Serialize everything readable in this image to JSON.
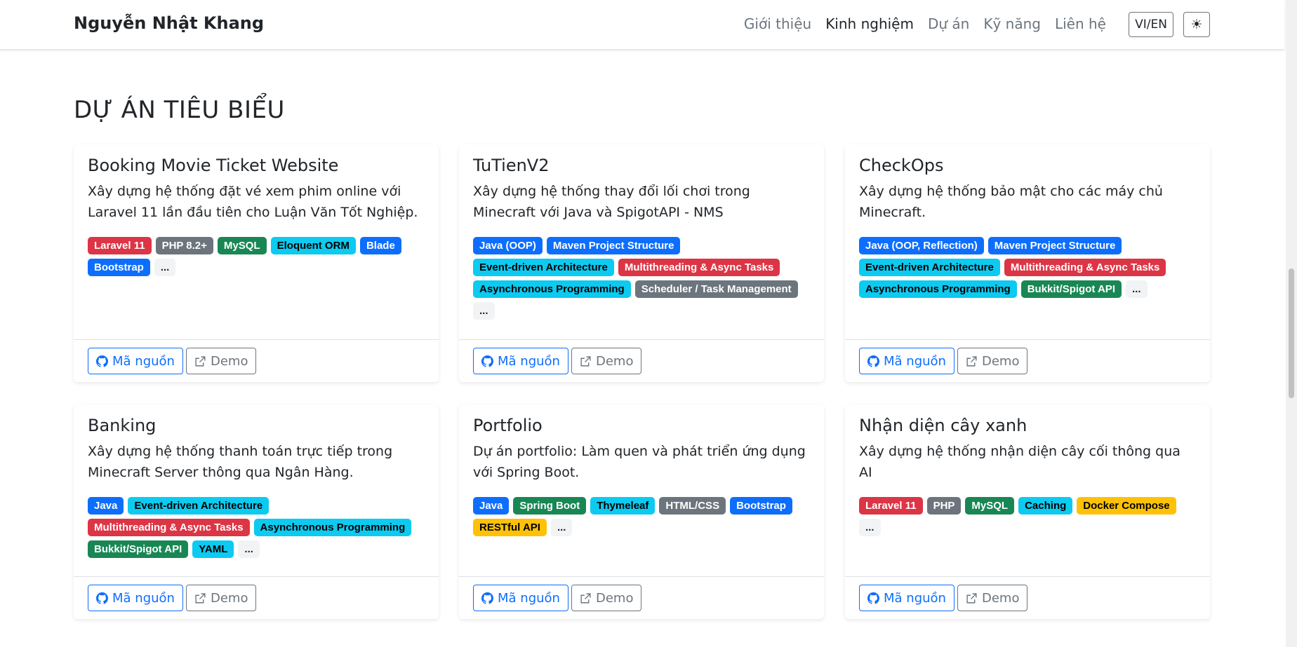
{
  "navbar": {
    "brand": "Nguyễn Nhật Khang",
    "links": [
      {
        "label": "Giới thiệu",
        "active": false
      },
      {
        "label": "Kinh nghiệm",
        "active": true
      },
      {
        "label": "Dự án",
        "active": false
      },
      {
        "label": "Kỹ năng",
        "active": false
      },
      {
        "label": "Liên hệ",
        "active": false
      }
    ],
    "lang_label": "VI/EN",
    "theme_icon": "sun-icon",
    "theme_glyph": "☀"
  },
  "section_title": "DỰ ÁN TIÊU BIỂU",
  "colors": {
    "danger": "#dc3545",
    "secondary": "#6c757d",
    "success": "#198754",
    "info": "#0dcaf0",
    "primary": "#0d6efd",
    "warning": "#ffc107"
  },
  "projects": [
    {
      "title": "Booking Movie Ticket Website",
      "description": "Xây dựng hệ thống đặt vé xem phim online với Laravel 11 lần đầu tiên cho Luận Văn Tốt Nghiệp.",
      "tags": [
        {
          "label": "Laravel 11",
          "color": "#dc3545",
          "text": "#ffffff"
        },
        {
          "label": "PHP 8.2+",
          "color": "#6c757d",
          "text": "#ffffff"
        },
        {
          "label": "MySQL",
          "color": "#198754",
          "text": "#ffffff"
        },
        {
          "label": "Eloquent ORM",
          "color": "#0dcaf0",
          "text": "#000000"
        },
        {
          "label": "Blade",
          "color": "#0d6efd",
          "text": "#ffffff"
        },
        {
          "label": "Bootstrap",
          "color": "#0d6efd",
          "text": "#ffffff"
        },
        {
          "label": "...",
          "color": "",
          "text": ""
        }
      ],
      "source_label": "Mã nguồn",
      "demo_label": "Demo"
    },
    {
      "title": "TuTienV2",
      "description": "Xây dựng hệ thống thay đổi lối chơi trong Minecraft với Java và SpigotAPI - NMS",
      "tags": [
        {
          "label": "Java (OOP)",
          "color": "#0d6efd",
          "text": "#ffffff"
        },
        {
          "label": "Maven Project Structure",
          "color": "#0d6efd",
          "text": "#ffffff"
        },
        {
          "label": "Event-driven Architecture",
          "color": "#0dcaf0",
          "text": "#000000"
        },
        {
          "label": "Multithreading & Async Tasks",
          "color": "#dc3545",
          "text": "#ffffff"
        },
        {
          "label": "Asynchronous Programming",
          "color": "#0dcaf0",
          "text": "#000000"
        },
        {
          "label": "Scheduler / Task Management",
          "color": "#6c757d",
          "text": "#ffffff"
        },
        {
          "label": "...",
          "color": "",
          "text": ""
        }
      ],
      "source_label": "Mã nguồn",
      "demo_label": "Demo"
    },
    {
      "title": "CheckOps",
      "description": "Xây dựng hệ thống bảo mật cho các máy chủ Minecraft.",
      "tags": [
        {
          "label": "Java (OOP, Reflection)",
          "color": "#0d6efd",
          "text": "#ffffff"
        },
        {
          "label": "Maven Project Structure",
          "color": "#0d6efd",
          "text": "#ffffff"
        },
        {
          "label": "Event-driven Architecture",
          "color": "#0dcaf0",
          "text": "#000000"
        },
        {
          "label": "Multithreading & Async Tasks",
          "color": "#dc3545",
          "text": "#ffffff"
        },
        {
          "label": "Asynchronous Programming",
          "color": "#0dcaf0",
          "text": "#000000"
        },
        {
          "label": "Bukkit/Spigot API",
          "color": "#198754",
          "text": "#ffffff"
        },
        {
          "label": "...",
          "color": "",
          "text": ""
        }
      ],
      "source_label": "Mã nguồn",
      "demo_label": "Demo"
    },
    {
      "title": "Banking",
      "description": "Xây dựng hệ thống thanh toán trực tiếp trong Minecraft Server thông qua Ngân Hàng.",
      "tags": [
        {
          "label": "Java",
          "color": "#0d6efd",
          "text": "#ffffff"
        },
        {
          "label": "Event-driven Architecture",
          "color": "#0dcaf0",
          "text": "#000000"
        },
        {
          "label": "Multithreading & Async Tasks",
          "color": "#dc3545",
          "text": "#ffffff"
        },
        {
          "label": "Asynchronous Programming",
          "color": "#0dcaf0",
          "text": "#000000"
        },
        {
          "label": "Bukkit/Spigot API",
          "color": "#198754",
          "text": "#ffffff"
        },
        {
          "label": "YAML",
          "color": "#0dcaf0",
          "text": "#000000"
        },
        {
          "label": "...",
          "color": "",
          "text": ""
        }
      ],
      "source_label": "Mã nguồn",
      "demo_label": "Demo"
    },
    {
      "title": "Portfolio",
      "description": "Dự án portfolio: Làm quen và phát triển ứng dụng với Spring Boot.",
      "tags": [
        {
          "label": "Java",
          "color": "#0d6efd",
          "text": "#ffffff"
        },
        {
          "label": "Spring Boot",
          "color": "#198754",
          "text": "#ffffff"
        },
        {
          "label": "Thymeleaf",
          "color": "#0dcaf0",
          "text": "#000000"
        },
        {
          "label": "HTML/CSS",
          "color": "#6c757d",
          "text": "#ffffff"
        },
        {
          "label": "Bootstrap",
          "color": "#0d6efd",
          "text": "#ffffff"
        },
        {
          "label": "RESTful API",
          "color": "#ffc107",
          "text": "#000000"
        },
        {
          "label": "...",
          "color": "",
          "text": ""
        }
      ],
      "source_label": "Mã nguồn",
      "demo_label": "Demo"
    },
    {
      "title": "Nhận diện cây xanh",
      "description": "Xây dựng hệ thống nhận diện cây cối thông qua AI",
      "tags": [
        {
          "label": "Laravel 11",
          "color": "#dc3545",
          "text": "#ffffff"
        },
        {
          "label": "PHP",
          "color": "#6c757d",
          "text": "#ffffff"
        },
        {
          "label": "MySQL",
          "color": "#198754",
          "text": "#ffffff"
        },
        {
          "label": "Caching",
          "color": "#0dcaf0",
          "text": "#000000"
        },
        {
          "label": "Docker Compose",
          "color": "#ffc107",
          "text": "#000000"
        },
        {
          "label": "...",
          "color": "",
          "text": ""
        }
      ],
      "source_label": "Mã nguồn",
      "demo_label": "Demo"
    }
  ],
  "icons": {
    "source": "github-icon",
    "demo": "external-link-icon"
  }
}
